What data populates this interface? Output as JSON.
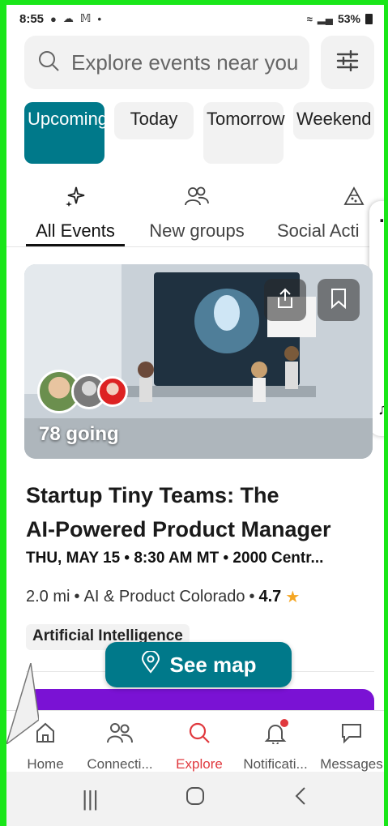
{
  "status_bar": {
    "time": "8:55",
    "battery": "53%"
  },
  "search": {
    "placeholder": "Explore events near you"
  },
  "date_chips": [
    "Upcoming",
    "Today",
    "Tomorrow",
    "Weekend"
  ],
  "category_tabs": [
    "All Events",
    "New groups",
    "Social Acti"
  ],
  "event": {
    "going": "78 going",
    "title_line1": "Startup Tiny Teams: The",
    "title_line2": "AI-Powered Product Manager",
    "when": "THU, MAY 15 • 8:30 AM MT • 2000 Centr...",
    "distance": "2.0 mi",
    "group": "AI & Product Colorado",
    "rating": "4.7",
    "tag": "Artificial Intelligence"
  },
  "see_map": {
    "label": "See map"
  },
  "bottom_nav": {
    "home": "Home",
    "connections": "Connecti...",
    "explore": "Explore",
    "notifications": "Notificati...",
    "messages": "Messages"
  },
  "colors": {
    "accent": "#00798a",
    "active_nav": "#e0393e",
    "card2": "#7a12d4"
  }
}
